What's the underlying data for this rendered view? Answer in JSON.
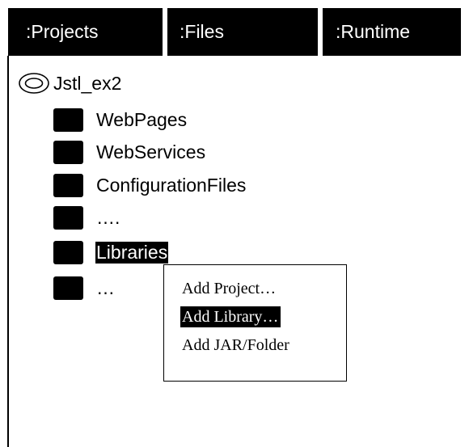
{
  "tabs": [
    {
      "label": ":Projects"
    },
    {
      "label": ":Files"
    },
    {
      "label": ":Runtime"
    }
  ],
  "tree": {
    "root": {
      "label": "Jstl_ex2",
      "icon": "project-icon"
    },
    "nodes": [
      {
        "label": "WebPages",
        "icon": "folder-icon"
      },
      {
        "label": "WebServices",
        "icon": "folder-icon"
      },
      {
        "label": "ConfigurationFiles",
        "icon": "folder-icon"
      },
      {
        "label": "….",
        "icon": "folder-icon"
      },
      {
        "label": "Libraries",
        "icon": "folder-icon",
        "selected": true
      },
      {
        "label": "…",
        "icon": "folder-icon"
      }
    ]
  },
  "context_menu": {
    "items": [
      {
        "label": "Add  Project…"
      },
      {
        "label": "Add Library…",
        "selected": true
      },
      {
        "label": "Add JAR/Folder"
      }
    ]
  },
  "colors": {
    "background": "#ffffff",
    "foreground": "#000000",
    "selection_bg": "#000000",
    "selection_fg": "#ffffff"
  }
}
